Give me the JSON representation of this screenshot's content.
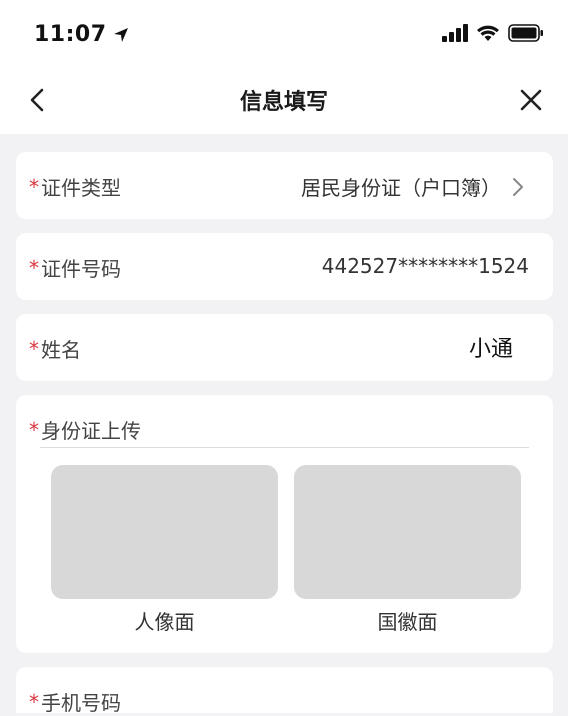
{
  "status_bar": {
    "time": "11:07"
  },
  "nav": {
    "title": "信息填写"
  },
  "form": {
    "required_mark": "*",
    "id_type": {
      "label": "证件类型",
      "value": "居民身份证（户口簿）"
    },
    "id_number": {
      "label": "证件号码",
      "value": "442527********1524"
    },
    "name": {
      "label": "姓名",
      "value": "小通"
    },
    "id_upload": {
      "label": "身份证上传",
      "front_label": "人像面",
      "back_label": "国徽面"
    },
    "phone": {
      "label": "手机号码"
    }
  },
  "colors": {
    "required": "#d9363e",
    "page_bg": "#f2f2f4",
    "card_bg": "#ffffff",
    "placeholder_bg": "#d8d8d8"
  },
  "icons": {
    "location": "location-arrow-icon",
    "signal": "cellular-signal-icon",
    "wifi": "wifi-icon",
    "battery": "battery-icon",
    "back": "chevron-left-icon",
    "close": "close-icon",
    "disclosure": "chevron-right-icon"
  }
}
